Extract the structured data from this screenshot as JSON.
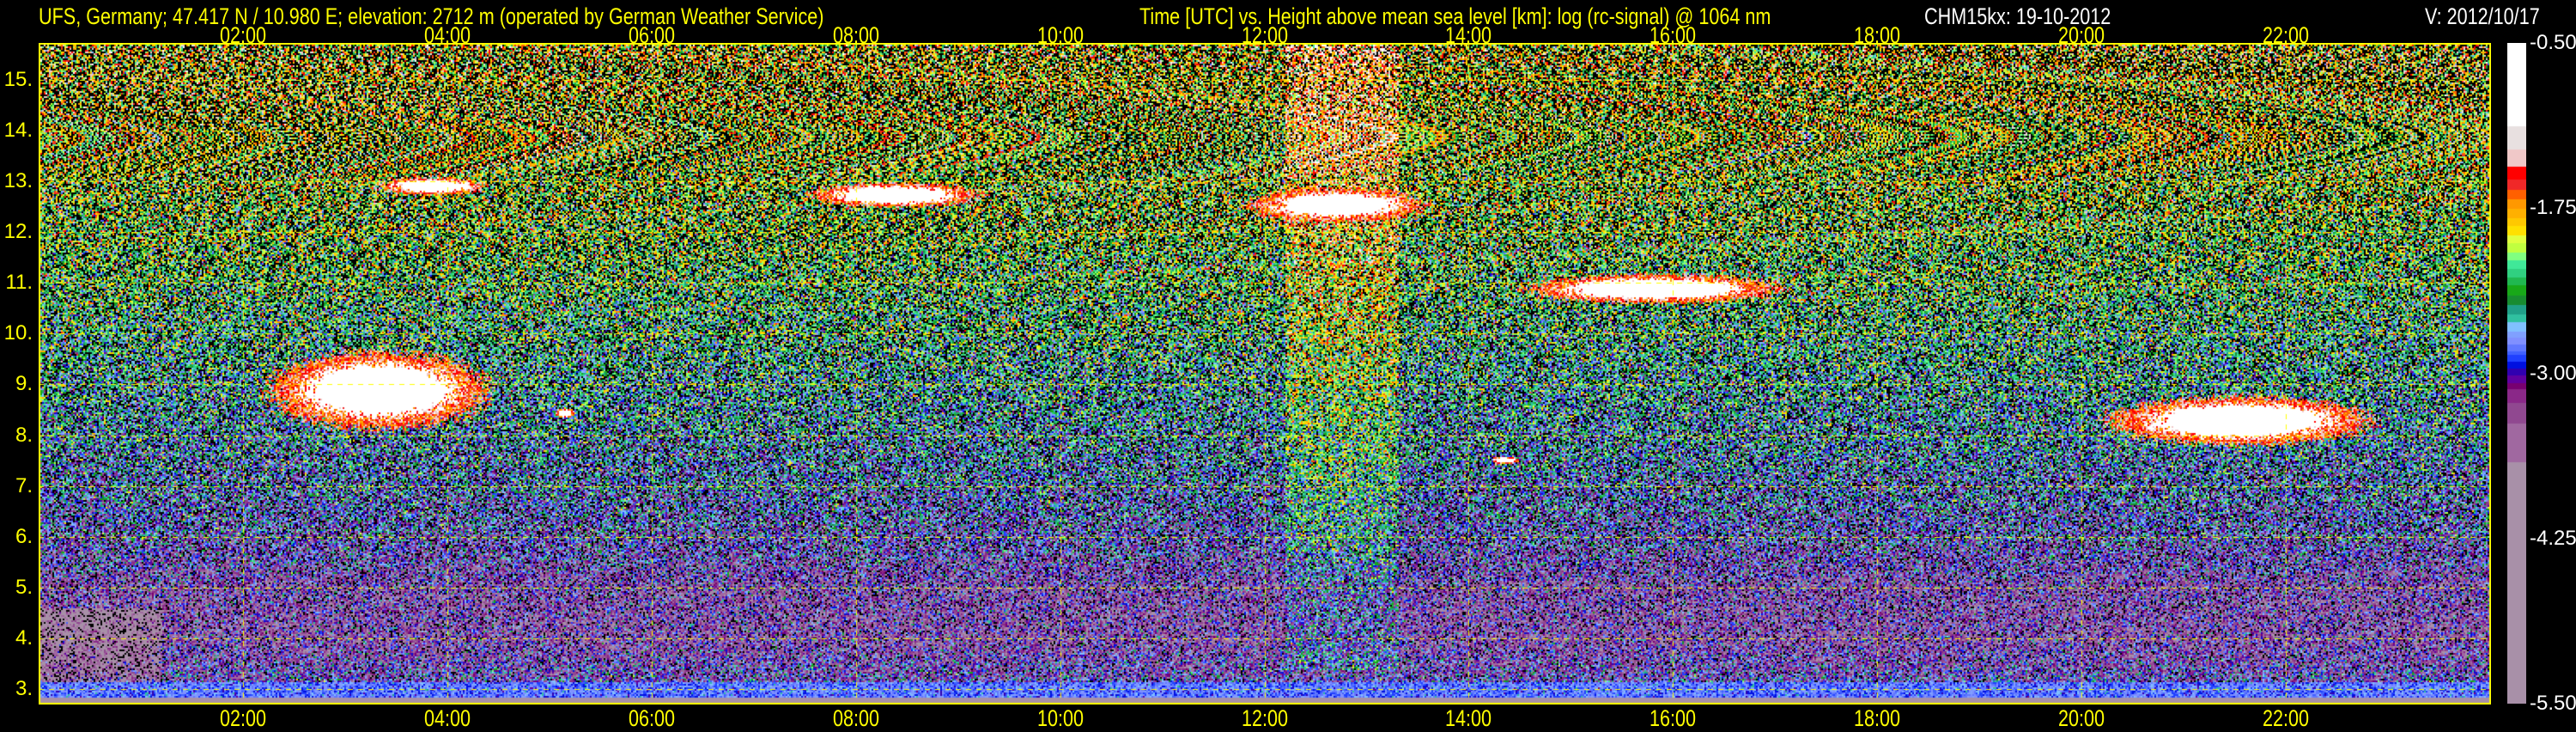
{
  "header": {
    "station": "UFS, Germany; 47.417 N / 10.980 E; elevation: 2712 m  (operated by German Weather Service)",
    "title": "Time [UTC] vs. Height above mean sea level [km]: log (rc-signal) @ 1064 nm",
    "instrument": "CHM15kx: 19-10-2012",
    "version": "V: 2012/10/17"
  },
  "chart_data": {
    "type": "heatmap",
    "title": "Time [UTC] vs. Height above mean sea level [km]: log (rc-signal) @ 1064 nm",
    "xlabel": "Time [UTC]",
    "ylabel": "Height above mean sea level [km]",
    "xlim": [
      0,
      24
    ],
    "ylim": [
      2.71,
      15.73
    ],
    "x_ticks": [
      "02:00",
      "04:00",
      "06:00",
      "08:00",
      "10:00",
      "12:00",
      "14:00",
      "16:00",
      "18:00",
      "20:00",
      "22:00"
    ],
    "x_tick_hours": [
      2,
      4,
      6,
      8,
      10,
      12,
      14,
      16,
      18,
      20,
      22
    ],
    "y_ticks": [
      "3.",
      "4.",
      "5.",
      "6.",
      "7.",
      "8.",
      "9.",
      "10.",
      "11.",
      "12.",
      "13.",
      "14.",
      "15."
    ],
    "y_tick_values": [
      3,
      4,
      5,
      6,
      7,
      8,
      9,
      10,
      11,
      12,
      13,
      14,
      15
    ],
    "grid": true,
    "colorbar": {
      "range": [
        -5.5,
        -0.5
      ],
      "tick_labels": [
        "-0.50",
        "-1.75",
        "-3.00",
        "-4.25",
        "-5.50"
      ],
      "tick_values": [
        -0.5,
        -1.75,
        -3.0,
        -4.25,
        -5.5
      ],
      "colormap": [
        {
          "min": -1.125,
          "color": "#ffffff"
        },
        {
          "min": -1.3,
          "color": "#e8e0e0"
        },
        {
          "min": -1.435,
          "color": "#f0c8c8"
        },
        {
          "min": -1.53,
          "color": "#ff0000"
        },
        {
          "min": -1.61,
          "color": "#f02828"
        },
        {
          "min": -1.68,
          "color": "#ff6000"
        },
        {
          "min": -1.75,
          "color": "#ff9800"
        },
        {
          "min": -1.82,
          "color": "#ffb000"
        },
        {
          "min": -1.88,
          "color": "#ffc800"
        },
        {
          "min": -1.95,
          "color": "#ffe000"
        },
        {
          "min": -2.01,
          "color": "#e0ff40"
        },
        {
          "min": -2.08,
          "color": "#c0ff40"
        },
        {
          "min": -2.14,
          "color": "#80ff80"
        },
        {
          "min": -2.21,
          "color": "#40e898"
        },
        {
          "min": -2.27,
          "color": "#30d080"
        },
        {
          "min": -2.33,
          "color": "#20b850"
        },
        {
          "min": -2.41,
          "color": "#18a818"
        },
        {
          "min": -2.48,
          "color": "#188c30"
        },
        {
          "min": -2.55,
          "color": "#20a088"
        },
        {
          "min": -2.61,
          "color": "#30c0a0"
        },
        {
          "min": -2.68,
          "color": "#80c0ff"
        },
        {
          "min": -2.73,
          "color": "#80a0ff"
        },
        {
          "min": -2.78,
          "color": "#8090ff"
        },
        {
          "min": -2.83,
          "color": "#6078ff"
        },
        {
          "min": -2.86,
          "color": "#4060ff"
        },
        {
          "min": -2.91,
          "color": "#2040ff"
        },
        {
          "min": -2.96,
          "color": "#0010e0"
        },
        {
          "min": -3.01,
          "color": "#3000b0"
        },
        {
          "min": -3.07,
          "color": "#6000a0"
        },
        {
          "min": -3.12,
          "color": "#780070"
        },
        {
          "min": -3.22,
          "color": "#8a2888"
        },
        {
          "min": -3.38,
          "color": "#904890"
        },
        {
          "min": -3.67,
          "color": "#a068a0"
        },
        {
          "min": -5.5,
          "color": "#a890a8"
        }
      ]
    },
    "cloud_layers": [
      {
        "t": [
          2.2,
          4.45
        ],
        "h": [
          8.1,
          9.7
        ]
      },
      {
        "t": [
          3.3,
          4.4
        ],
        "h": [
          12.75,
          13.1
        ]
      },
      {
        "t": [
          5.05,
          5.25
        ],
        "h": [
          8.35,
          8.55
        ]
      },
      {
        "t": [
          7.5,
          9.25
        ],
        "h": [
          12.5,
          13.0
        ]
      },
      {
        "t": [
          11.8,
          13.6
        ],
        "h": [
          12.2,
          12.9
        ]
      },
      {
        "t": [
          14.5,
          17.1
        ],
        "h": [
          10.6,
          11.2
        ]
      },
      {
        "t": [
          14.2,
          14.5
        ],
        "h": [
          7.45,
          7.6
        ]
      },
      {
        "t": [
          20.2,
          22.9
        ],
        "h": [
          7.8,
          8.8
        ]
      }
    ]
  },
  "colors": {
    "axis": "#ffff00",
    "background": "#000000"
  }
}
